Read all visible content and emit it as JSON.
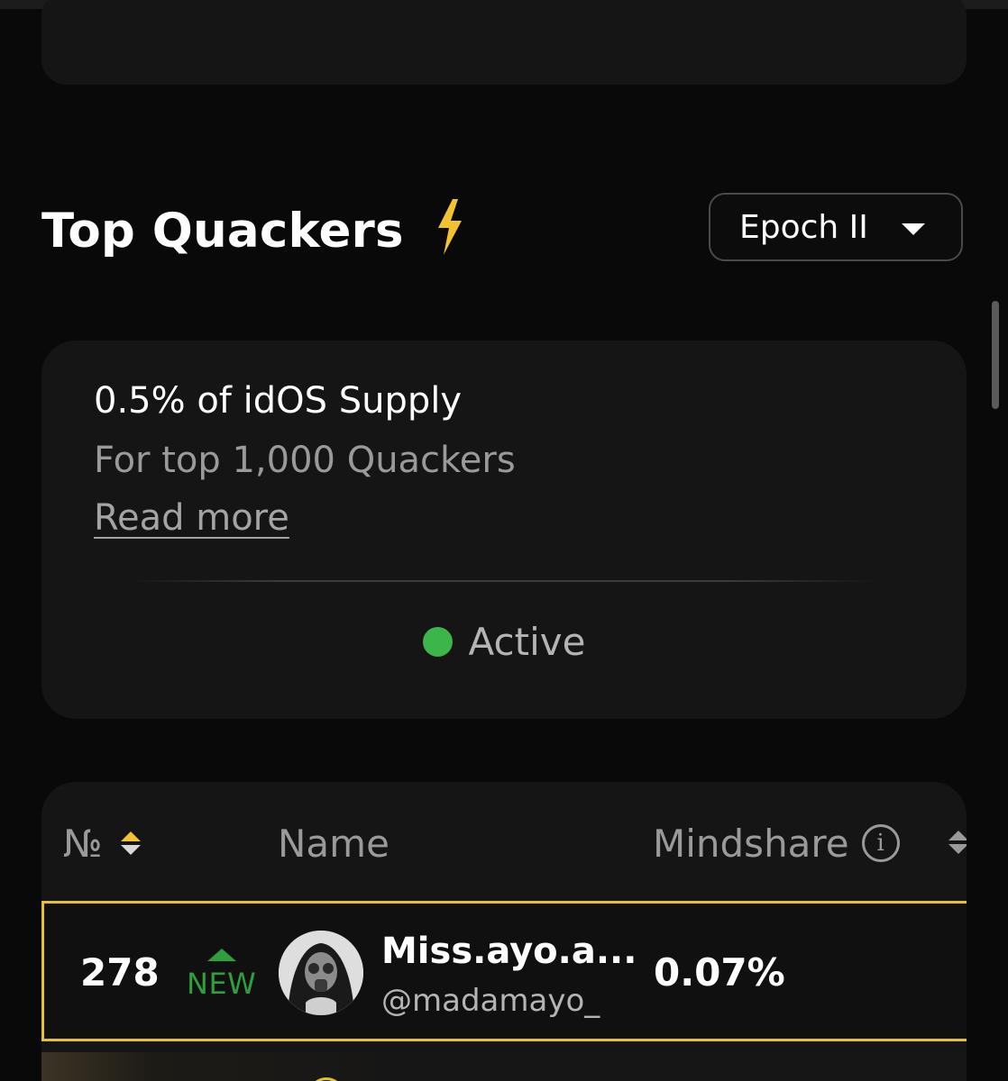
{
  "section": {
    "title": "Top Quackers",
    "title_icon": "lightning-bolt-icon"
  },
  "epoch_select": {
    "selected": "Epoch II",
    "icon": "caret-down-icon"
  },
  "info_card": {
    "headline": "0.5% of idOS Supply",
    "subline": "For top 1,000 Quackers",
    "read_more": "Read more",
    "status": "Active",
    "status_color": "#3cb54a"
  },
  "table": {
    "columns": {
      "rank": "№",
      "name": "Name",
      "mindshare": "Mindshare"
    },
    "rows": [
      {
        "rank": "278",
        "badge": "NEW",
        "display_name": "Miss.ayo.a...",
        "handle": "@madamayo_",
        "mindshare": "0.07%",
        "highlighted": true
      }
    ]
  },
  "colors": {
    "accent": "#f2c230",
    "highlight_border": "#e5c033",
    "new_badge": "#2f9e3c",
    "background": "#090909",
    "card": "#151515"
  }
}
